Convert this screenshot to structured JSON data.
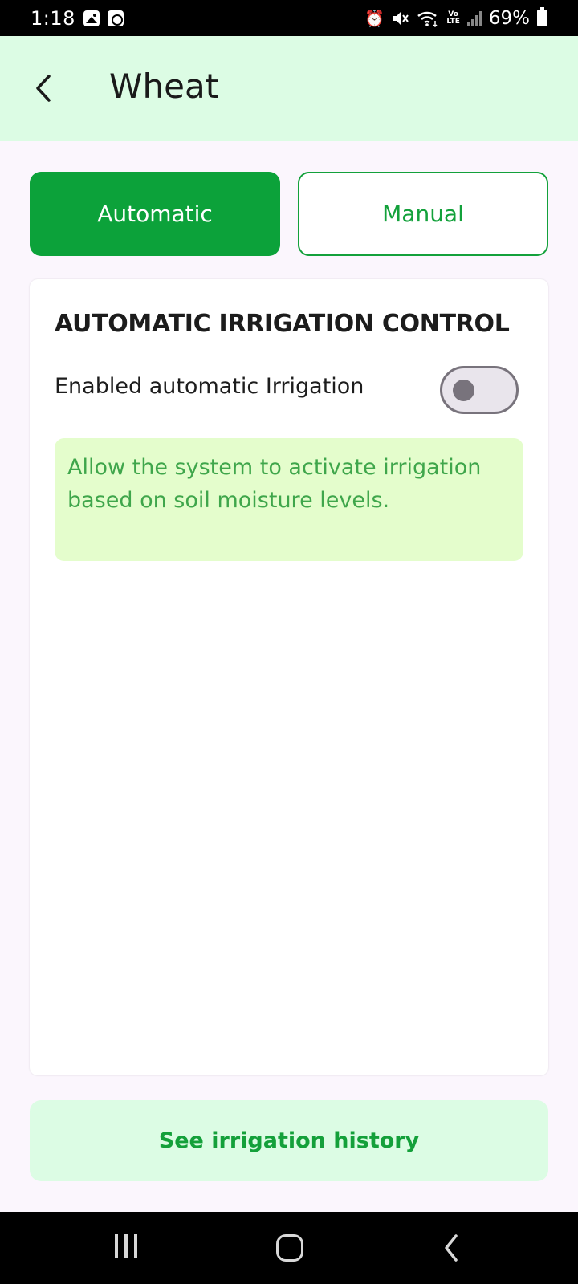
{
  "status_bar": {
    "time": "1:18",
    "battery": "69%",
    "icons": [
      "gallery-icon",
      "screen-recorder-icon",
      "alarm-icon",
      "mute-icon",
      "wifi-icon",
      "volte-icon",
      "signal-icon",
      "battery-icon"
    ],
    "volte_top": "Vo",
    "volte_bottom": "LTE"
  },
  "app_bar": {
    "title": "Wheat",
    "back_icon": "chevron-left-icon"
  },
  "tabs": [
    {
      "label": "Automatic",
      "active": true
    },
    {
      "label": "Manual",
      "active": false
    }
  ],
  "card": {
    "title": "AUTOMATIC IRRIGATION CONTROL",
    "toggle_label": "Enabled automatic Irrigation",
    "toggle_on": false,
    "info_text": "Allow the system to activate irrigation based on soil moisture levels."
  },
  "history_button": {
    "label": "See irrigation history"
  },
  "colors": {
    "primary": "#0ca23a",
    "app_bar_bg": "#dcfce4",
    "info_bg": "#e4fdcc",
    "info_text": "#3fa64b",
    "page_bg": "#fbf6fd"
  },
  "nav_bar": {
    "icons": [
      "recents-icon",
      "home-icon",
      "back-icon"
    ]
  }
}
